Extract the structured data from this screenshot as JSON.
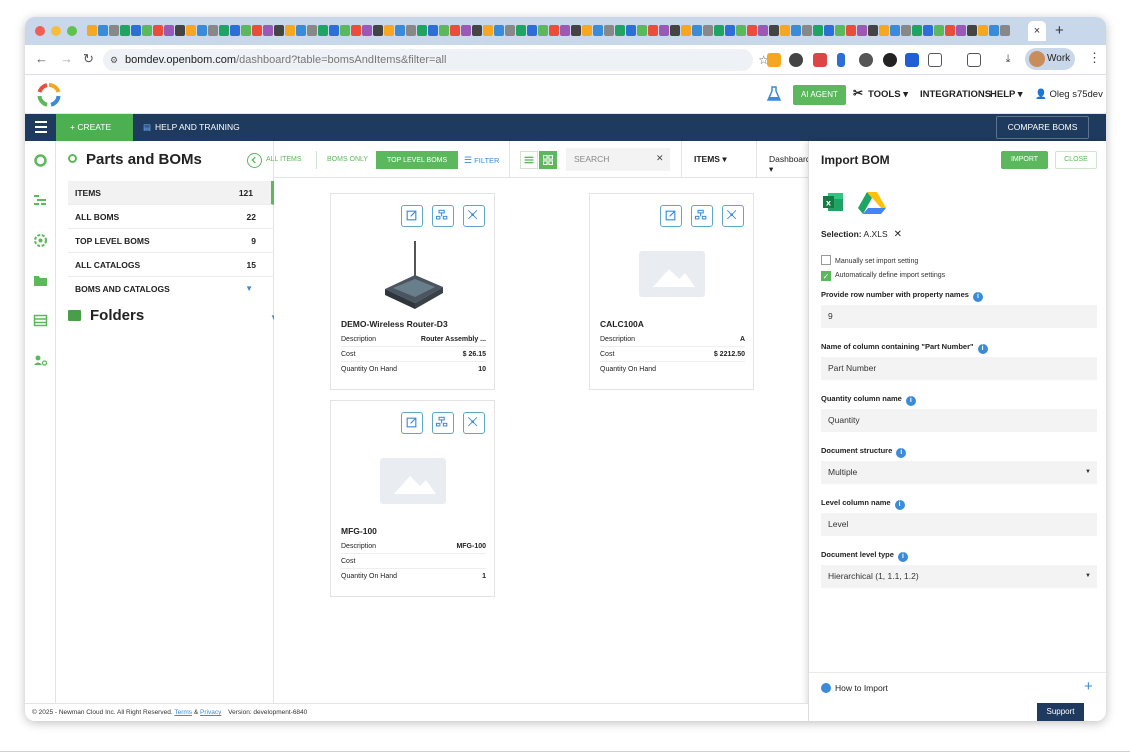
{
  "browser": {
    "active_tab_close": "×",
    "new_tab": "+",
    "url_host": "bomdev.openbom.com",
    "url_path": "/dashboard?table=bomsAndItems&filter=all",
    "profile_label": "Work"
  },
  "header": {
    "ai_agent": "AI AGENT",
    "tools": "TOOLS",
    "integrations": "INTEGRATIONS",
    "help": "HELP",
    "user": "Oleg s75dev"
  },
  "toolbar": {
    "create": "+ CREATE",
    "help_training": "HELP AND TRAINING",
    "compare": "COMPARE BOMS"
  },
  "left_panel": {
    "title": "Parts and BOMs",
    "items": [
      {
        "label": "ITEMS",
        "count": "121"
      },
      {
        "label": "ALL BOMS",
        "count": "22"
      },
      {
        "label": "TOP LEVEL BOMS",
        "count": "9"
      },
      {
        "label": "ALL CATALOGS",
        "count": "15"
      },
      {
        "label": "BOMS AND CATALOGS",
        "count": ""
      }
    ],
    "folders": "Folders"
  },
  "filter_bar": {
    "all_items": "ALL ITEMS",
    "boms_only": "BOMS ONLY",
    "top_level": "TOP LEVEL BOMS",
    "filter": "FILTER",
    "search_placeholder": "SEARCH",
    "items_drop": "ITEMS",
    "dashboard_drop": "Dashboard"
  },
  "cards": [
    {
      "name": "DEMO-Wireless Router-D3",
      "props": [
        {
          "k": "Description",
          "v": "Router Assembly ..."
        },
        {
          "k": "Cost",
          "v": "$ 26.15"
        },
        {
          "k": "Quantity On Hand",
          "v": "10"
        }
      ]
    },
    {
      "name": "CALC100A",
      "props": [
        {
          "k": "Description",
          "v": "A"
        },
        {
          "k": "Cost",
          "v": "$ 2212.50"
        },
        {
          "k": "Quantity On Hand",
          "v": ""
        }
      ]
    },
    {
      "name": "MFG-100",
      "props": [
        {
          "k": "Description",
          "v": "MFG-100"
        },
        {
          "k": "Cost",
          "v": ""
        },
        {
          "k": "Quantity On Hand",
          "v": "1"
        }
      ]
    }
  ],
  "import_panel": {
    "title": "Import BOM",
    "import_btn": "IMPORT",
    "close_btn": "CLOSE",
    "selection_label": "Selection:",
    "selection_value": "A.XLS",
    "manual_setting": "Manually set import setting",
    "auto_setting": "Automatically define import settings",
    "row_label": "Provide row number with property names",
    "row_value": "9",
    "part_col_label": "Name of column containing \"Part Number\"",
    "part_col_value": "Part Number",
    "qty_col_label": "Quantity column name",
    "qty_col_value": "Quantity",
    "doc_struct_label": "Document structure",
    "doc_struct_value": "Multiple",
    "level_col_label": "Level column name",
    "level_col_value": "Level",
    "doc_level_label": "Document level type",
    "doc_level_value": "Hierarchical (1, 1.1, 1.2)",
    "how_to": "How to Import"
  },
  "footer": {
    "copyright": "© 2025 - Newman Cloud Inc. All Right Reserved.",
    "terms": "Terms",
    "amp": "&",
    "privacy": "Privacy",
    "version": "Version: development-6840",
    "support": "Support"
  },
  "colors": {
    "accent_green": "#5cb85c",
    "navy": "#1e3a5f",
    "link_blue": "#3a8bd8"
  }
}
